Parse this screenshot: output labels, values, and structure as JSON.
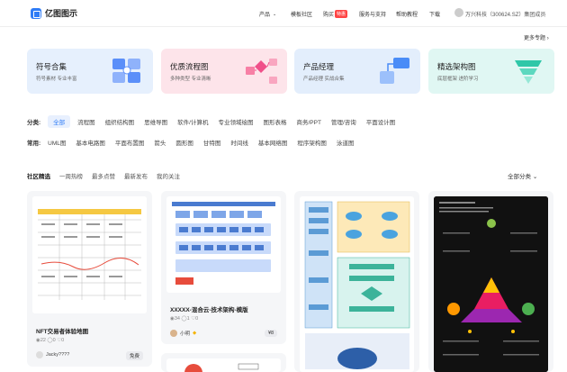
{
  "header": {
    "logo_text": "亿图图示",
    "nav": [
      "产品",
      "模板社区",
      "购买",
      "服务与支持",
      "帮助教程",
      "下载"
    ],
    "hot_badge": "特惠",
    "company": "万兴科技（300624.SZ）集团成员"
  },
  "more_topics": "更多专题",
  "topic_cards": [
    {
      "title": "符号合集",
      "sub": "符号素材 专业丰富",
      "bg": "#e6f0fd"
    },
    {
      "title": "优质流程图",
      "sub": "多种类型 专业清晰",
      "bg": "#fde4ea"
    },
    {
      "title": "产品经理",
      "sub": "产品经理 实战合集",
      "bg": "#e3eefc"
    },
    {
      "title": "精选架构图",
      "sub": "底层框架 进阶学习",
      "bg": "#e0f7f3"
    }
  ],
  "filters": {
    "category_label": "分类:",
    "categories": [
      "全部",
      "流程图",
      "组织结构图",
      "思维导图",
      "软件/计算机",
      "专业领域绘图",
      "图形表格",
      "商务/PPT",
      "管理/咨询",
      "平面设计图"
    ],
    "common_label": "常用:",
    "common": [
      "UML图",
      "基本电路图",
      "平面布置图",
      "箭头",
      "圆形图",
      "甘特图",
      "时间线",
      "基本网络图",
      "程序架构图",
      "泳道图"
    ]
  },
  "tabs": [
    "社区精选",
    "一周热榜",
    "最多点赞",
    "最新发布",
    "我的关注"
  ],
  "sort_label": "全部分类",
  "gallery": [
    {
      "title": "NFT交易者体验地图",
      "views": "22",
      "comments": "0",
      "likes": "0",
      "author": "Jacky????",
      "badge": "免费"
    },
    {
      "title": "XXXXX-混合云-技术架构-模版",
      "views": "34",
      "comments": "1",
      "likes": "0",
      "author": "小明",
      "badge": "¥8"
    }
  ]
}
